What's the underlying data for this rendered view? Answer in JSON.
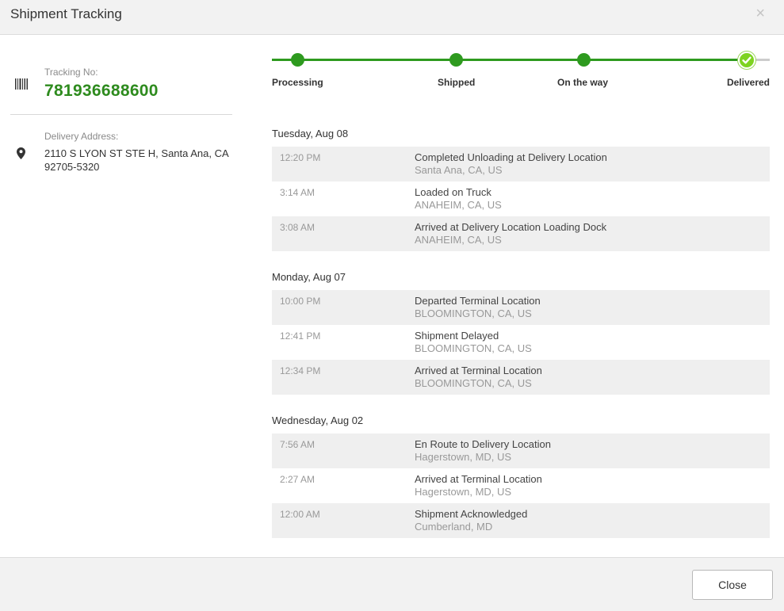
{
  "dialog": {
    "title": "Shipment Tracking",
    "close_icon": "×",
    "close_button": "Close"
  },
  "tracking": {
    "label": "Tracking No:",
    "number": "781936688600"
  },
  "address": {
    "label": "Delivery Address:",
    "line1": "2110 S LYON ST STE H, Santa Ana, CA",
    "line2": "92705-5320"
  },
  "progress": {
    "steps": [
      {
        "label": "Processing"
      },
      {
        "label": "Shipped"
      },
      {
        "label": "On the way"
      },
      {
        "label": "Delivered"
      }
    ],
    "active_color": "#2e9a1f",
    "delivered_color": "#7ed321"
  },
  "days": [
    {
      "title": "Tuesday, Aug 08",
      "events": [
        {
          "time": "12:20 PM",
          "desc": "Completed Unloading at Delivery Location",
          "loc": "Santa Ana, CA, US"
        },
        {
          "time": "3:14 AM",
          "desc": "Loaded on Truck",
          "loc": "ANAHEIM, CA, US"
        },
        {
          "time": "3:08 AM",
          "desc": "Arrived at Delivery Location Loading Dock",
          "loc": "ANAHEIM, CA, US"
        }
      ]
    },
    {
      "title": "Monday, Aug 07",
      "events": [
        {
          "time": "10:00 PM",
          "desc": "Departed Terminal Location",
          "loc": "BLOOMINGTON, CA, US"
        },
        {
          "time": "12:41 PM",
          "desc": "Shipment Delayed",
          "loc": "BLOOMINGTON, CA, US"
        },
        {
          "time": "12:34 PM",
          "desc": "Arrived at Terminal Location",
          "loc": "BLOOMINGTON, CA, US"
        }
      ]
    },
    {
      "title": "Wednesday, Aug 02",
      "events": [
        {
          "time": "7:56 AM",
          "desc": "En Route to Delivery Location",
          "loc": "Hagerstown, MD, US"
        },
        {
          "time": "2:27 AM",
          "desc": "Arrived at Terminal Location",
          "loc": "Hagerstown, MD, US"
        },
        {
          "time": "12:00 AM",
          "desc": "Shipment Acknowledged",
          "loc": "Cumberland, MD"
        }
      ]
    }
  ],
  "icons": {
    "barcode": "barcode-icon",
    "location": "map-pin-icon",
    "check": "check-icon",
    "close": "close-icon"
  }
}
